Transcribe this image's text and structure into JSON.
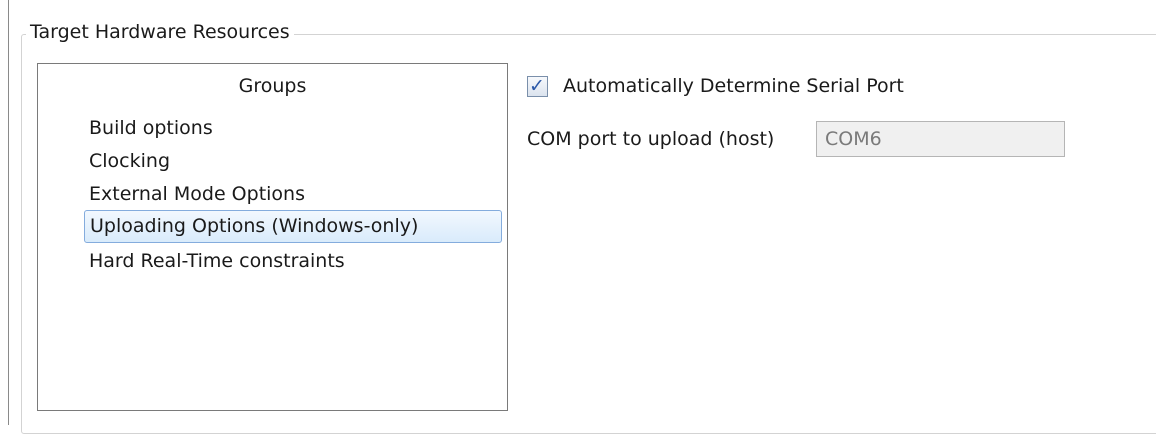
{
  "fieldset": {
    "legend": "Target Hardware Resources"
  },
  "groups": {
    "header": "Groups",
    "items": [
      {
        "label": "Build options",
        "selected": false
      },
      {
        "label": "Clocking",
        "selected": false
      },
      {
        "label": "External Mode Options",
        "selected": false
      },
      {
        "label": "Uploading Options (Windows-only)",
        "selected": true
      },
      {
        "label": "Hard Real-Time constraints",
        "selected": false
      }
    ]
  },
  "options": {
    "auto_serial": {
      "label": "Automatically Determine Serial Port",
      "checked": true
    },
    "com_port": {
      "label": "COM port to upload (host)",
      "value": "COM6",
      "disabled": true
    }
  },
  "colors": {
    "selection_border": "#84acdd",
    "checkmark": "#2b58a8",
    "disabled_field_bg": "#f0f0f0"
  }
}
